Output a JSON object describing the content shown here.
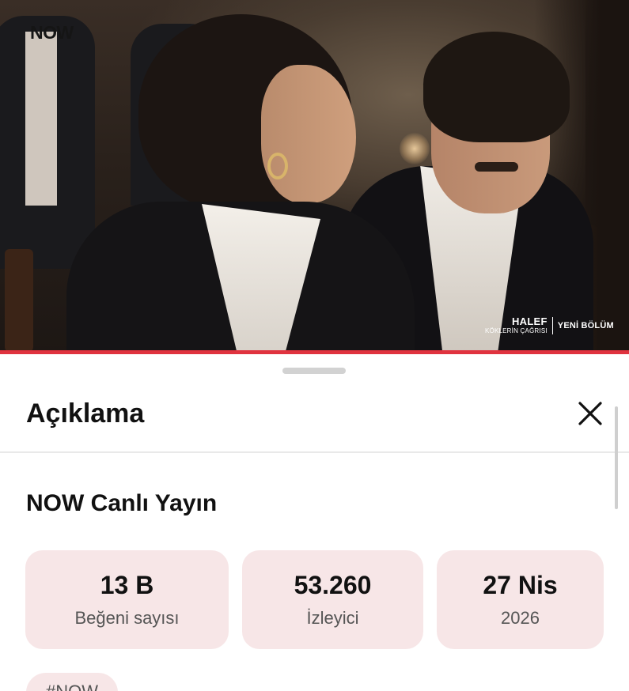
{
  "video": {
    "logo": "NOW",
    "watermark": {
      "show_title": "HALEF",
      "show_subtitle": "KÖKLERİN ÇAĞRISI",
      "badge": "YENİ BÖLÜM"
    },
    "progress_fraction": 1.0,
    "accent_color": "#e0333f"
  },
  "sheet": {
    "title": "Açıklama",
    "close_icon": "close-icon",
    "channel_name": "NOW Canlı Yayın",
    "stats": [
      {
        "value": "13 B",
        "label": "Beğeni sayısı"
      },
      {
        "value": "53.260",
        "label": "İzleyici"
      },
      {
        "value": "27 Nis",
        "label": "2026"
      }
    ],
    "tags": [
      "#NOW"
    ],
    "card_color": "#f7e6e7"
  }
}
